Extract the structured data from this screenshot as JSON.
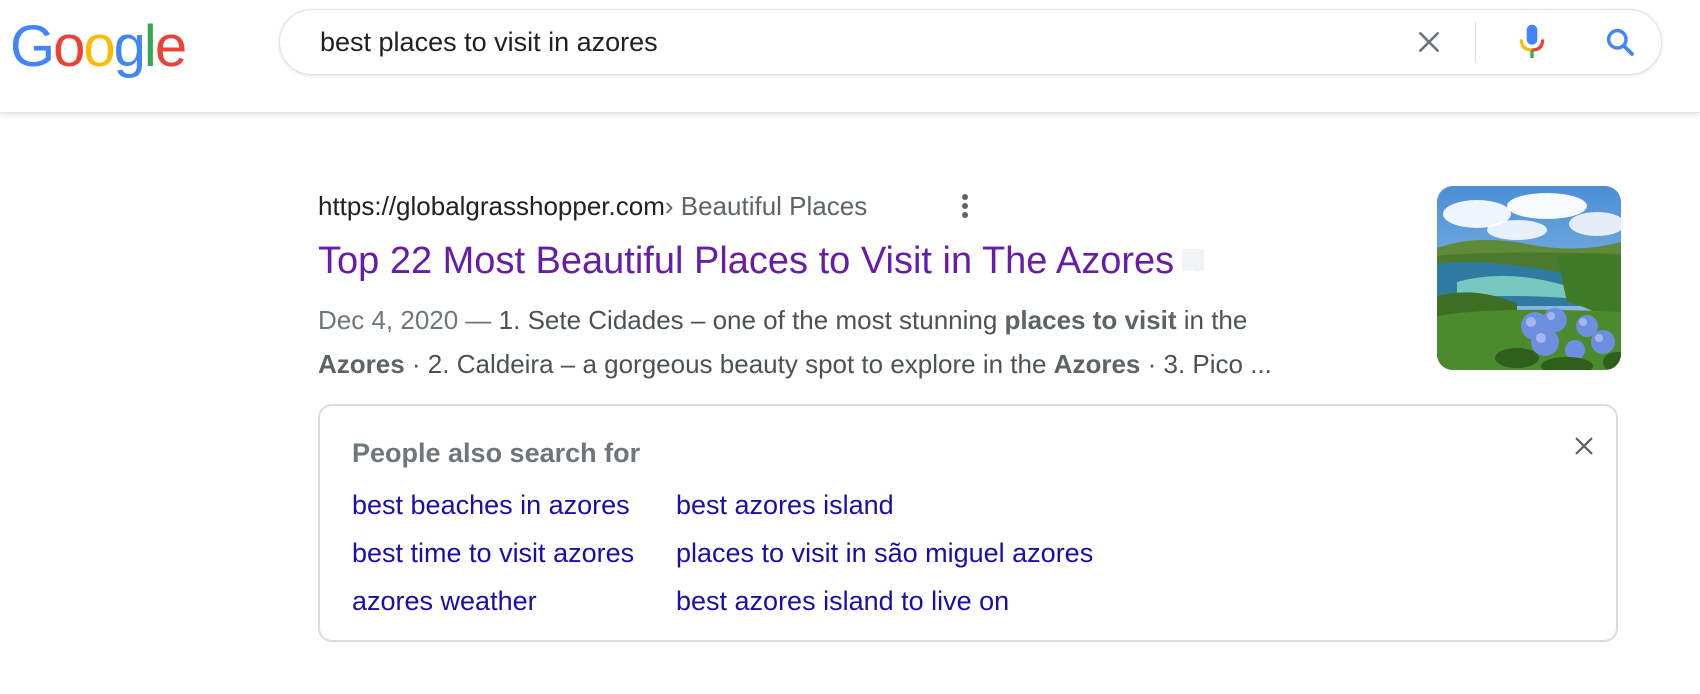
{
  "header": {
    "logo_letters": [
      {
        "char": "G",
        "color": "#4285F4"
      },
      {
        "char": "o",
        "color": "#EA4335"
      },
      {
        "char": "o",
        "color": "#FBBC05"
      },
      {
        "char": "g",
        "color": "#4285F4"
      },
      {
        "char": "l",
        "color": "#34A853"
      },
      {
        "char": "e",
        "color": "#EA4335"
      }
    ],
    "search_query": "best places to visit in azores",
    "icons": {
      "clear": "close-icon",
      "voice": "microphone-icon",
      "search": "search-icon"
    }
  },
  "result": {
    "url": "https://globalgrasshopper.com",
    "breadcrumb": " › Beautiful Places",
    "title": "Top 22 Most Beautiful Places to Visit in The Azores",
    "date": "Dec 4, 2020 — ",
    "snippet_parts": {
      "p1": "1. Sete Cidades – one of the most stunning ",
      "b1": "places to visit",
      "p2": " in the",
      "b2": "Azores",
      "p3": " · 2. Caldeira – a gorgeous beauty spot to explore in the ",
      "b3": "Azores",
      "p4": " · 3. Pico ..."
    },
    "thumbnail_icon": "azores-landscape-image"
  },
  "people_also_search": {
    "heading": "People also search for",
    "links": [
      "best beaches in azores",
      "best time to visit azores",
      "azores weather",
      "best azores island",
      "places to visit in são miguel azores",
      "best azores island to live on"
    ]
  },
  "colors": {
    "visited_link": "#681da8",
    "link": "#1a0dab",
    "text": "#202124",
    "muted": "#70757a"
  }
}
